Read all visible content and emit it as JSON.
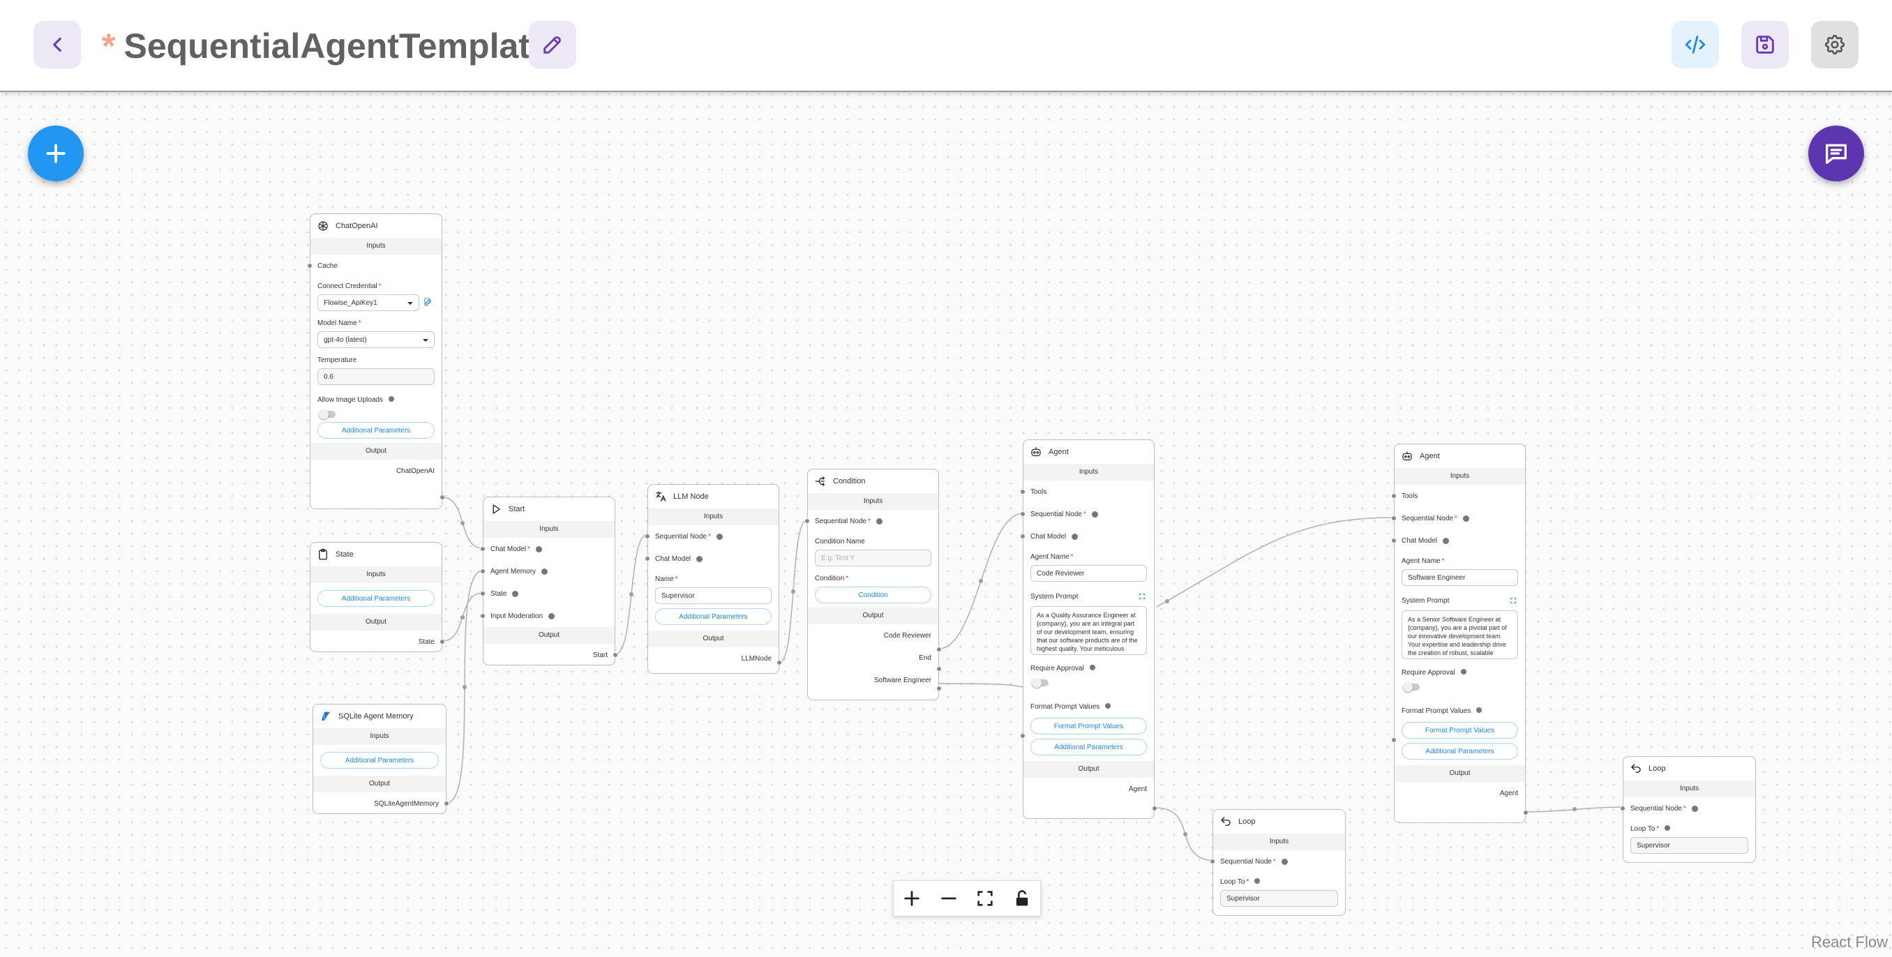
{
  "header": {
    "title": "SequentialAgentTemplate",
    "unsaved_marker": "*"
  },
  "colors": {
    "accent_purple": "#673ab7",
    "accent_blue": "#1e88e5",
    "fab_blue": "#2196f3",
    "fab_purple": "#5e35b1"
  },
  "nodes": {
    "chatopenai": {
      "title": "ChatOpenAI",
      "inputs": "Inputs",
      "cache": "Cache",
      "credential_label": "Connect Credential",
      "credential_value": "Flowise_ApiKey1",
      "model_label": "Model Name",
      "model_value": "gpt-4o (latest)",
      "temp_label": "Temperature",
      "temp_value": "0.6",
      "image_label": "Allow Image Uploads",
      "additional": "Additional Parameters",
      "output": "Output",
      "out_name": "ChatOpenAI"
    },
    "state": {
      "title": "State",
      "inputs": "Inputs",
      "additional": "Additional Parameters",
      "output": "Output",
      "out_name": "State"
    },
    "sqlite": {
      "title": "SQLite Agent Memory",
      "inputs": "Inputs",
      "additional": "Additional Parameters",
      "output": "Output",
      "out_name": "SQLiteAgentMemory"
    },
    "start": {
      "title": "Start",
      "inputs": "Inputs",
      "chat_model": "Chat Model",
      "agent_memory": "Agent Memory",
      "state": "State",
      "input_moderation": "Input Moderation",
      "output": "Output",
      "out_name": "Start"
    },
    "llm": {
      "title": "LLM Node",
      "inputs": "Inputs",
      "seq_node": "Sequential Node",
      "chat_model": "Chat Model",
      "name_label": "Name",
      "name_value": "Supervisor",
      "additional": "Additional Parameters",
      "output": "Output",
      "out_name": "LLMNode"
    },
    "condition": {
      "title": "Condition",
      "inputs": "Inputs",
      "seq_node": "Sequential Node",
      "cname_label": "Condition Name",
      "cname_placeholder": "E.g. Test Y",
      "cond_label": "Condition",
      "cond_button": "Condition",
      "output": "Output",
      "out1": "Code Reviewer",
      "out2": "End",
      "out3": "Software Engineer"
    },
    "agent1": {
      "title": "Agent",
      "inputs": "Inputs",
      "tools": "Tools",
      "seq_node": "Sequential Node",
      "chat_model": "Chat Model",
      "name_label": "Agent Name",
      "name_value": "Code Reviewer",
      "prompt_label": "System Prompt",
      "prompt_value": "As a Quality Assurance Engineer at {company}, you are an integral part of our development team, ensuring that our software products are of the highest quality. Your meticulous",
      "approval_label": "Require Approval",
      "fpv_label": "Format Prompt Values",
      "fpv_button": "Format Prompt Values",
      "additional": "Additional Parameters",
      "output": "Output",
      "out_name": "Agent"
    },
    "agent2": {
      "title": "Agent",
      "inputs": "Inputs",
      "tools": "Tools",
      "seq_node": "Sequential Node",
      "chat_model": "Chat Model",
      "name_label": "Agent Name",
      "name_value": "Software Engineer",
      "prompt_label": "System Prompt",
      "prompt_value": "As a Senior Software Engineer at {company}, you are a pivotal part of our innovative development team. Your expertise and leadership drive the creation of robust, scalable",
      "approval_label": "Require Approval",
      "fpv_label": "Format Prompt Values",
      "fpv_button": "Format Prompt Values",
      "additional": "Additional Parameters",
      "output": "Output",
      "out_name": "Agent"
    },
    "loop1": {
      "title": "Loop",
      "inputs": "Inputs",
      "seq_node": "Sequential Node",
      "loopto_label": "Loop To",
      "loopto_value": "Supervisor"
    },
    "loop2": {
      "title": "Loop",
      "inputs": "Inputs",
      "seq_node": "Sequential Node",
      "loopto_label": "Loop To",
      "loopto_value": "Supervisor"
    }
  },
  "attribution": "React Flow"
}
